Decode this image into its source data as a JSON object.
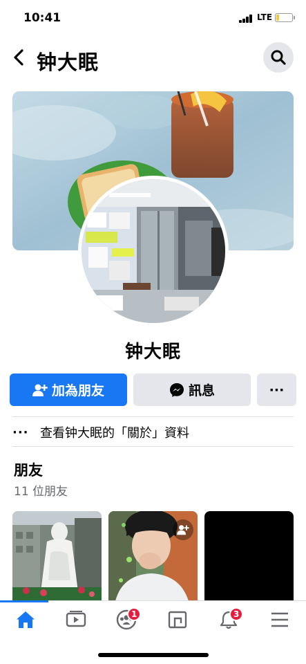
{
  "status_bar": {
    "time": "10:41",
    "network": "LTE"
  },
  "header": {
    "title": "钟大眠",
    "back_icon": "chevron-left-icon",
    "search_icon": "search-icon"
  },
  "profile": {
    "name": "钟大眠",
    "cover_description_icon": "cover-photo",
    "avatar_icon": "profile-photo"
  },
  "actions": {
    "add_friend_label": "加為朋友",
    "message_label": "訊息",
    "more_label": "···",
    "accent": "#1877f2"
  },
  "about": {
    "dots": "···",
    "label": "查看钟大眠的「關於」資料"
  },
  "friends": {
    "title": "朋友",
    "count": "11 位朋友"
  },
  "bottom_nav": {
    "items": [
      {
        "icon": "home-icon"
      },
      {
        "icon": "watch-icon"
      },
      {
        "icon": "groups-icon",
        "badge": "1"
      },
      {
        "icon": "marketplace-icon"
      },
      {
        "icon": "bell-icon",
        "badge": "3"
      },
      {
        "icon": "menu-icon"
      }
    ]
  }
}
